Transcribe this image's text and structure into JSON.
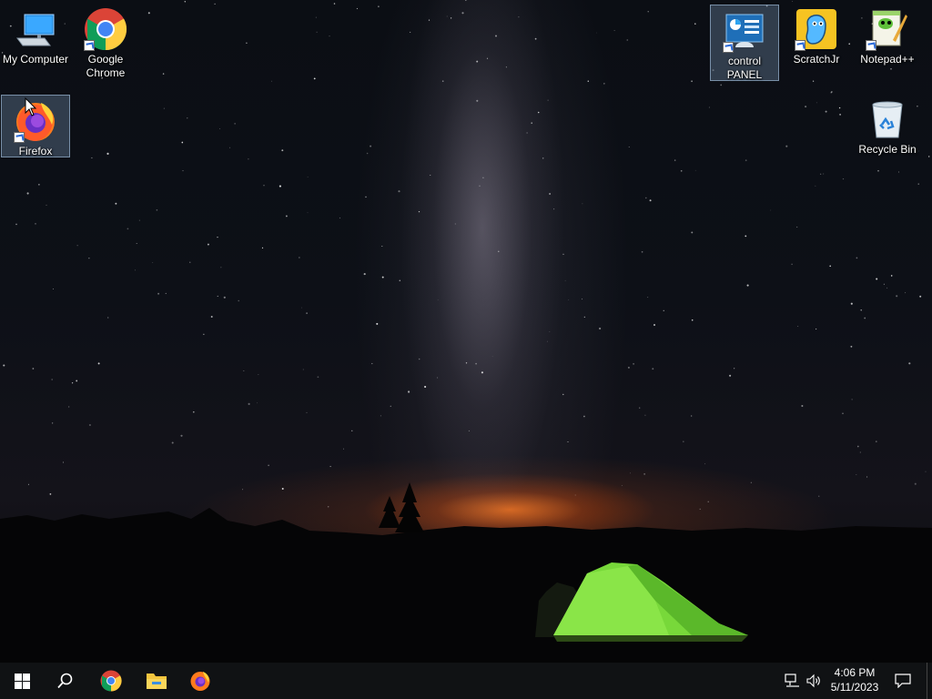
{
  "desktop": {
    "icons": [
      {
        "label": "My Computer",
        "icon": "computer-icon"
      },
      {
        "label": "Google Chrome",
        "icon": "chrome-icon"
      },
      {
        "label": "Firefox",
        "icon": "firefox-icon",
        "selected": true
      },
      {
        "label": "control PANEL",
        "icon": "control-panel-icon",
        "selected": true
      },
      {
        "label": "ScratchJr",
        "icon": "scratchjr-icon"
      },
      {
        "label": "Notepad++",
        "icon": "notepad-plus-plus-icon"
      },
      {
        "label": "Recycle Bin",
        "icon": "recycle-bin-icon"
      }
    ]
  },
  "taskbar": {
    "pinned": [
      "start-icon",
      "search-icon",
      "chrome-icon",
      "file-explorer-icon",
      "firefox-icon"
    ],
    "tray": [
      "network-icon",
      "volume-icon"
    ],
    "time": "4:06 PM",
    "date": "5/11/2023",
    "notification": "notification-icon"
  },
  "colors": {
    "taskbar": "#101214",
    "accent": "#2a6ad8",
    "tent": "#7ee03a"
  }
}
